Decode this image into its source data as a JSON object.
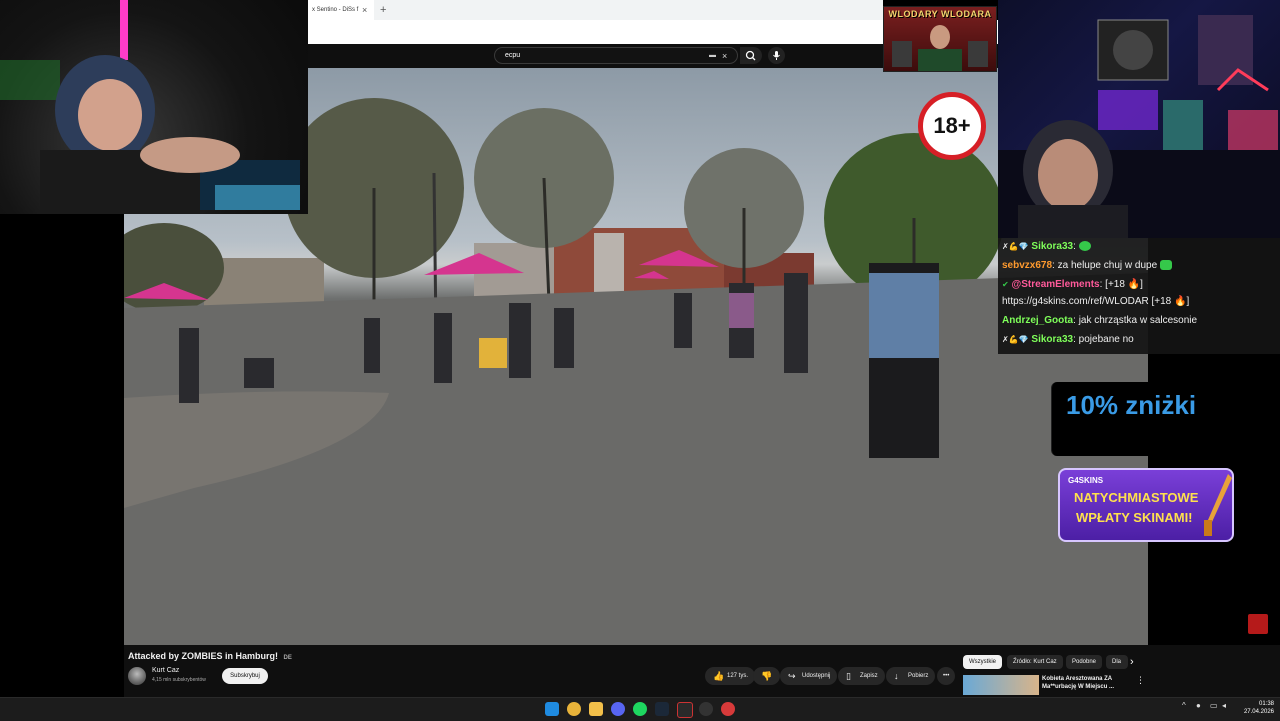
{
  "browser": {
    "tab_title": "x Sentino - DiSs f",
    "tab_close": "×",
    "new_tab": "+",
    "search_query": "ecpu",
    "keyboard_icon": "keyboard-icon",
    "clear_icon": "×"
  },
  "overlay": {
    "banner_text": "WLODARY WLODARA",
    "age_badge": "18+",
    "discount_text": "10% zniżki",
    "g4_brand": "G4SKINS",
    "g4_line1": "NATYCHMIASTOWE",
    "g4_line2": "WPŁATY SKINAMI!"
  },
  "chat": {
    "messages": [
      {
        "user": "Sikora33",
        "user_color": "#7fff5a",
        "text": "",
        "prefix": "✗💪💎"
      },
      {
        "user": "sebvzx678",
        "user_color": "#ff9a2e",
        "text": "za helupe chuj w dupe",
        "prefix": ""
      },
      {
        "user": "@StreamElements",
        "user_color": "#ff5a9a",
        "text": "[+18 🔥]",
        "prefix": "✔"
      },
      {
        "user": "",
        "user_color": "#eeeeee",
        "text": "https://g4skins.com/ref/WLODAR [+18 🔥]",
        "prefix": ""
      },
      {
        "user": "Andrzej_Goota",
        "user_color": "#7fff5a",
        "text": "jak chrząstka w salcesonie",
        "prefix": ""
      },
      {
        "user": "Sikora33",
        "user_color": "#7fff5a",
        "text": "pojebane no",
        "prefix": "✗💪💎"
      }
    ]
  },
  "video": {
    "title": "Attacked by ZOMBIES in Hamburg!",
    "title_suffix": "DE",
    "channel": "Kurt Caz",
    "subscribers": "4,15 mln subskrybentów",
    "subscribe": "Subskrybuj",
    "likes": "127 tys.",
    "share": "Udostępnij",
    "save": "Zapisz",
    "download": "Pobierz",
    "more": "•••"
  },
  "recommendations": {
    "chips": [
      "Wszystkie",
      "Źródło: Kurt Caz",
      "Podobne",
      "Dla"
    ],
    "next": "›",
    "item_title": "Kobieta Aresztowana ZA Ma**urbację W Miejscu ...",
    "item_more": "⋮"
  },
  "taskbar": {
    "time": "01:38",
    "date": "27.04.2026",
    "tray_chevron": "^"
  },
  "colors": {
    "youtube_bg": "#0f0f0f",
    "discount_blue": "#3a9be6",
    "promo_purple": "#7a3fd8",
    "badge_red": "#d61f26"
  }
}
